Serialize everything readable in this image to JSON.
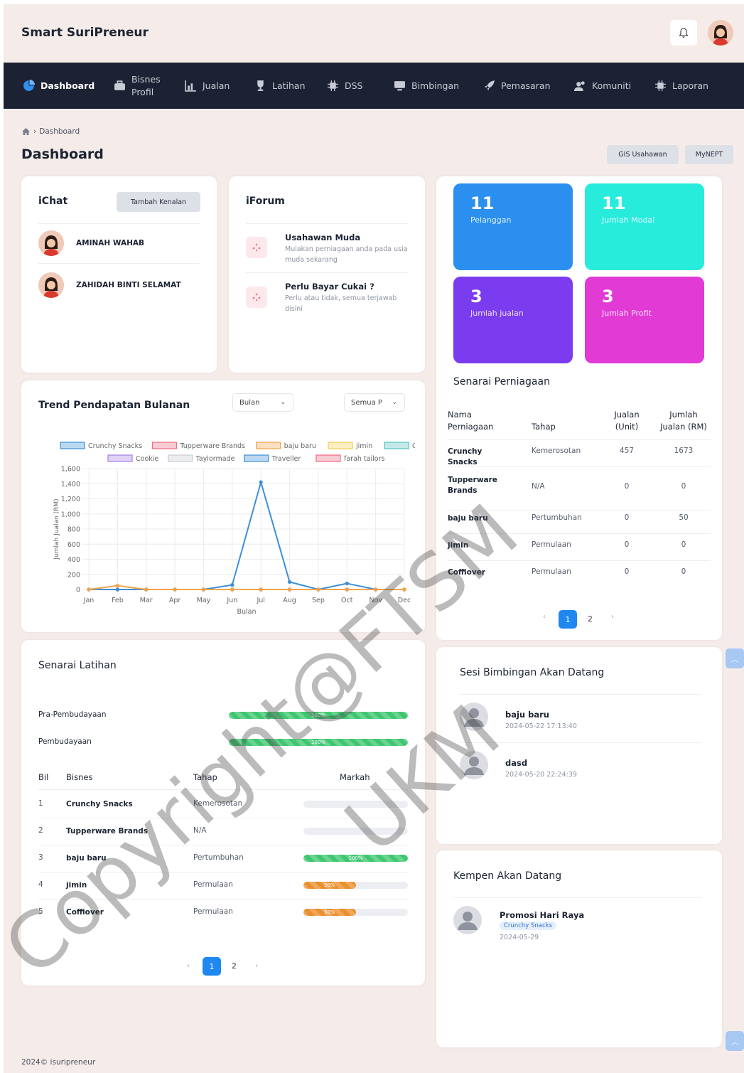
{
  "app": {
    "brand": "Smart SuriPreneur"
  },
  "nav": [
    {
      "label": "Dashboard",
      "icon": "dashboard-icon"
    },
    {
      "label": "Bisnes Profil",
      "icon": "briefcase-icon"
    },
    {
      "label": "Jualan",
      "icon": "chart-icon"
    },
    {
      "label": "Latihan",
      "icon": "trophy-icon"
    },
    {
      "label": "DSS",
      "icon": "cpu-icon"
    },
    {
      "label": "Bimbingan",
      "icon": "monitor-icon"
    },
    {
      "label": "Pemasaran",
      "icon": "rocket-icon"
    },
    {
      "label": "Komuniti",
      "icon": "users-icon"
    },
    {
      "label": "Laporan",
      "icon": "cpu-icon"
    }
  ],
  "breadcrumb": {
    "current": "Dashboard"
  },
  "page": {
    "title": "Dashboard",
    "btn_gis": "GIS Usahawan",
    "btn_mynept": "MyNEPT"
  },
  "ichat": {
    "title": "iChat",
    "add_btn": "Tambah Kenalan",
    "contacts": [
      "AMINAH WAHAB",
      "ZAHIDAH BINTI SELAMAT"
    ]
  },
  "iforum": {
    "title": "iForum",
    "posts": [
      {
        "title": "Usahawan Muda",
        "desc": "Mulakan perniagaan anda pada usia muda sekarang"
      },
      {
        "title": "Perlu Bayar Cukai ?",
        "desc": "Perlu atau tidak, semua terjawab disini"
      }
    ]
  },
  "stats": [
    {
      "value": "11",
      "label": "Pelanggan",
      "color": "#2b8ff0"
    },
    {
      "value": "11",
      "label": "Jumlah Modal",
      "color": "#27ecdc"
    },
    {
      "value": "3",
      "label": "Jumlah jualan",
      "color": "#7b3cf0"
    },
    {
      "value": "3",
      "label": "Jumlah Profit",
      "color": "#e13ad5"
    }
  ],
  "senarai_perniagaan": {
    "title": "Senarai Perniagaan",
    "headers": [
      "Nama Perniagaan",
      "Tahap",
      "Jualan (Unit)",
      "Jumlah Jualan (RM)"
    ],
    "rows": [
      [
        "Crunchy Snacks",
        "Kemerosotan",
        "457",
        "1673"
      ],
      [
        "Tupperware Brands",
        "N/A",
        "0",
        "0"
      ],
      [
        "baju baru",
        "Pertumbuhan",
        "0",
        "50"
      ],
      [
        "jimin",
        "Permulaan",
        "0",
        "0"
      ],
      [
        "Coffiover",
        "Permulaan",
        "0",
        "0"
      ]
    ],
    "pages": [
      "1",
      "2"
    ]
  },
  "trend": {
    "title": "Trend Pendapatan Bulanan",
    "select_period": "Bulan",
    "select_business": "Semua P"
  },
  "chart_data": {
    "type": "line",
    "title": "Trend Pendapatan Bulanan",
    "xlabel": "Bulan",
    "ylabel": "Jumlah Jualan (RM)",
    "ylim": [
      0,
      1600
    ],
    "y_ticks": [
      "0",
      "200",
      "400",
      "600",
      "800",
      "1,000",
      "1,200",
      "1,400",
      "1,600"
    ],
    "categories": [
      "Jan",
      "Feb",
      "Mar",
      "Apr",
      "May",
      "Jun",
      "Jul",
      "Aug",
      "Sep",
      "Oct",
      "Nov",
      "Dec"
    ],
    "legend_position": "top",
    "series": [
      {
        "name": "Crunchy Snacks",
        "color": "#3d8fd8",
        "values": [
          0,
          0,
          0,
          0,
          0,
          60,
          1420,
          100,
          0,
          80,
          0,
          0
        ]
      },
      {
        "name": "Tupperware Brands",
        "color": "#ef6a80",
        "values": [
          0,
          0,
          0,
          0,
          0,
          0,
          0,
          0,
          0,
          0,
          0,
          0
        ]
      },
      {
        "name": "baju baru",
        "color": "#f2a44a",
        "values": [
          0,
          50,
          0,
          0,
          0,
          0,
          0,
          0,
          0,
          0,
          0,
          0
        ]
      },
      {
        "name": "jimin",
        "color": "#f5cf50",
        "values": [
          0,
          0,
          0,
          0,
          0,
          0,
          0,
          0,
          0,
          0,
          0,
          0
        ]
      },
      {
        "name": "Coffiover",
        "color": "#56c1bf",
        "values": [
          0,
          0,
          0,
          0,
          0,
          0,
          0,
          0,
          0,
          0,
          0,
          0
        ]
      },
      {
        "name": "Cookie",
        "color": "#a57de8",
        "values": [
          0,
          0,
          0,
          0,
          0,
          0,
          0,
          0,
          0,
          0,
          0,
          0
        ]
      },
      {
        "name": "Taylormade",
        "color": "#c9ccd2",
        "values": [
          0,
          0,
          0,
          0,
          0,
          0,
          0,
          0,
          0,
          0,
          0,
          0
        ]
      },
      {
        "name": "Traveller",
        "color": "#3d8fd8",
        "values": [
          0,
          0,
          0,
          0,
          0,
          0,
          0,
          0,
          0,
          0,
          0,
          0
        ]
      },
      {
        "name": "farah tailors",
        "color": "#ef6a80",
        "values": [
          0,
          0,
          0,
          0,
          0,
          0,
          0,
          0,
          0,
          0,
          0,
          0
        ]
      }
    ]
  },
  "latihan": {
    "title": "Senarai Latihan",
    "progress": [
      {
        "label": "Pra-Pembudayaan",
        "value": "100%",
        "percent": 100
      },
      {
        "label": "Pembudayaan",
        "value": "100%",
        "percent": 100
      }
    ],
    "headers": [
      "Bil",
      "Bisnes",
      "Tahap",
      "Markah"
    ],
    "rows": [
      {
        "bil": "1",
        "bisnes": "Crunchy Snacks",
        "tahap": "Kemerosotan",
        "markah": "",
        "percent": 0,
        "color": ""
      },
      {
        "bil": "2",
        "bisnes": "Tupperware Brands",
        "tahap": "N/A",
        "markah": "",
        "percent": 0,
        "color": ""
      },
      {
        "bil": "3",
        "bisnes": "baju baru",
        "tahap": "Pertumbuhan",
        "markah": "100%",
        "percent": 100,
        "color": "#3fc770"
      },
      {
        "bil": "4",
        "bisnes": "jimin",
        "tahap": "Permulaan",
        "markah": "50%",
        "percent": 50,
        "color": "#ea8f2e"
      },
      {
        "bil": "5",
        "bisnes": "Coffiover",
        "tahap": "Permulaan",
        "markah": "50%",
        "percent": 50,
        "color": "#ea8f2e"
      }
    ],
    "pages": [
      "1",
      "2"
    ]
  },
  "bimbingan": {
    "title": "Sesi Bimbingan Akan Datang",
    "sessions": [
      {
        "name": "baju baru",
        "date": "2024-05-22 17:13:40"
      },
      {
        "name": "dasd",
        "date": "2024-05-20 22:24:39"
      }
    ]
  },
  "kempen": {
    "title": "Kempen Akan Datang",
    "items": [
      {
        "name": "Promosi Hari Raya",
        "tag": "Crunchy Snacks",
        "date": "2024-05-29"
      }
    ]
  },
  "footer": {
    "text": "2024© isuripreneur"
  },
  "watermark": {
    "line1": "Copyright@FTSM",
    "line2": "UKM"
  }
}
